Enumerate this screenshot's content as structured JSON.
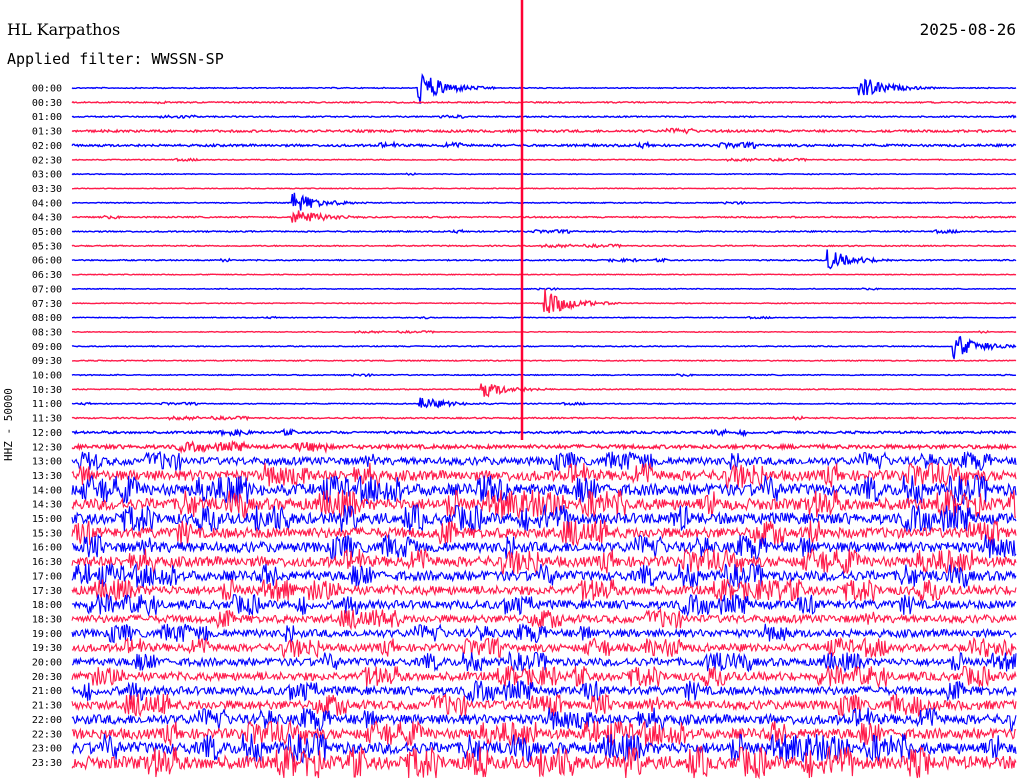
{
  "header": {
    "station": "HL Karpathos",
    "date": "2025-08-26",
    "filter": "Applied filter: WWSSN-SP"
  },
  "channel_label": "HHZ - 50000",
  "colors": {
    "trace_a": "#0000ff",
    "trace_b": "#ff1a4a",
    "marker": "#ff0033",
    "axis_text": "#000000"
  },
  "chart_data": {
    "type": "line",
    "description_free": true,
    "row_labels": [
      "00:00",
      "00:30",
      "01:00",
      "01:30",
      "02:00",
      "02:30",
      "03:00",
      "03:30",
      "04:00",
      "04:30",
      "05:00",
      "05:30",
      "06:00",
      "06:30",
      "07:00",
      "07:30",
      "08:00",
      "08:30",
      "09:00",
      "09:30",
      "10:00",
      "10:30",
      "11:00",
      "11:30",
      "12:00",
      "12:30",
      "13:00",
      "13:30",
      "14:00",
      "14:30",
      "15:00",
      "15:30",
      "16:00",
      "16:30",
      "17:00",
      "17:30",
      "18:00",
      "18:30",
      "19:00",
      "19:30",
      "20:00",
      "20:30",
      "21:00",
      "21:30",
      "22:00",
      "22:30",
      "23:00",
      "23:30"
    ],
    "trace_color_cycle": [
      "#0000ff",
      "#ff1a4a"
    ],
    "row_minutes": 30,
    "noise_level_by_row": [
      0.15,
      0.2,
      0.2,
      0.35,
      0.35,
      0.15,
      0.12,
      0.12,
      0.15,
      0.2,
      0.2,
      0.18,
      0.18,
      0.12,
      0.12,
      0.12,
      0.12,
      0.12,
      0.15,
      0.15,
      0.15,
      0.15,
      0.15,
      0.2,
      0.35,
      0.6,
      1.2,
      1.6,
      1.8,
      1.8,
      1.7,
      1.6,
      1.6,
      1.6,
      1.5,
      1.4,
      1.3,
      1.2,
      1.2,
      1.2,
      1.2,
      1.3,
      1.3,
      1.4,
      1.5,
      1.6,
      1.8,
      2.0
    ],
    "events": [
      {
        "row": 0,
        "minute": 11,
        "amplitude": 3.0
      },
      {
        "row": 0,
        "minute": 25,
        "amplitude": 2.2
      },
      {
        "row": 8,
        "minute": 7,
        "amplitude": 1.8
      },
      {
        "row": 9,
        "minute": 7,
        "amplitude": 1.6
      },
      {
        "row": 12,
        "minute": 24,
        "amplitude": 1.8
      },
      {
        "row": 15,
        "minute": 15,
        "amplitude": 2.5
      },
      {
        "row": 18,
        "minute": 28,
        "amplitude": 2.2
      },
      {
        "row": 21,
        "minute": 13,
        "amplitude": 1.5
      },
      {
        "row": 22,
        "minute": 11,
        "amplitude": 1.2
      }
    ],
    "marker_minute": 14.3
  }
}
